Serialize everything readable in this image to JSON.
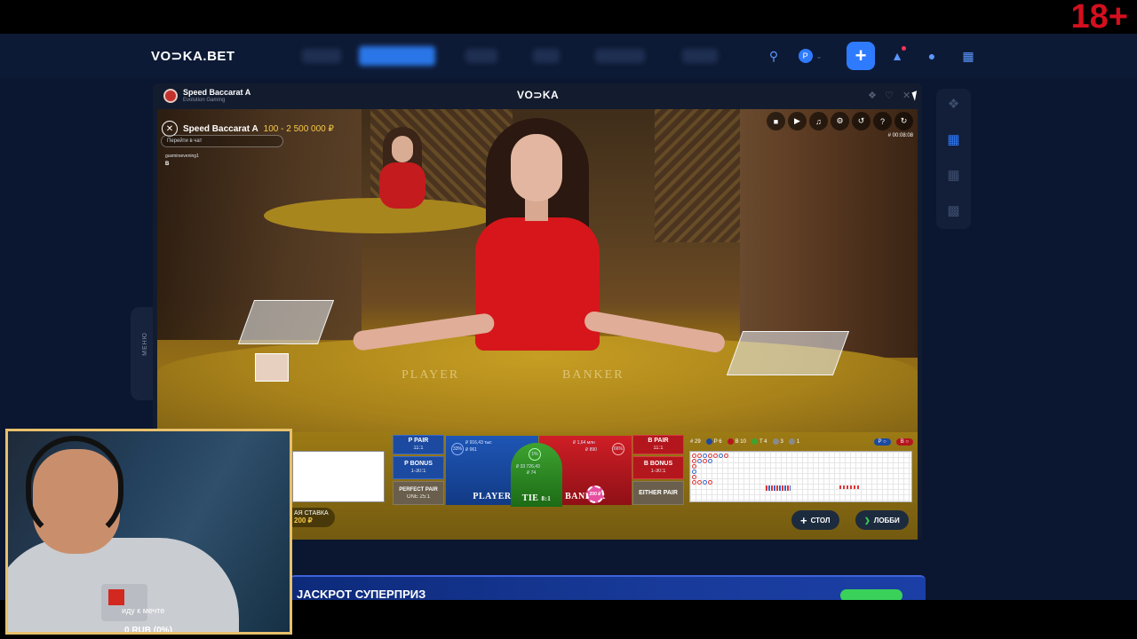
{
  "age_badge": "18+",
  "site": {
    "logo": "VO⊃KA.BET"
  },
  "game_window": {
    "title": "Speed Baccarat A",
    "provider": "Evolution Gaming",
    "brand": "VO⊃KA"
  },
  "video": {
    "game_name": "Speed Baccarat A",
    "limits": "100 - 2 500 000 ₽",
    "chat_placeholder": "Перейти в чат",
    "chat_user": "gusmirsevening1",
    "chat_message": "B",
    "round_id": "# 00:08:08",
    "table_player": "PLAYER",
    "table_banker": "BANKER"
  },
  "bets": {
    "p_pair": "P PAIR",
    "p_pair_odds": "11:1",
    "p_bonus": "P BONUS",
    "p_bonus_odds": "1-30:1",
    "perfect_pair": "PERFECT PAIR",
    "perfect_pair_odds": "ONE 25:1",
    "b_pair": "B PAIR",
    "b_pair_odds": "11:1",
    "b_bonus": "B BONUS",
    "b_bonus_odds": "1-30:1",
    "either_pair": "EITHER PAIR",
    "player": "PLAYER",
    "tie": "TIE",
    "tie_odds": "8:1",
    "banker": "BANKER",
    "player_pct": "33%",
    "banker_pct": "66%",
    "tie_pct": "1%",
    "player_total": "₽ 916,43 тыс",
    "player_count": "₽ 061",
    "banker_total": "₽ 1,64 млн",
    "banker_count": "₽ 890",
    "tie_total": "₽ 33 726,43",
    "tie_count": "₽ 74",
    "chip_value": "200 ₽",
    "last_bet_label": "АЯ СТАВКА",
    "last_bet_value": "200 ₽"
  },
  "road_stats": {
    "total": "# 29",
    "player": "P 6",
    "banker": "B 10",
    "tie": "T 4",
    "bpair": "3",
    "ppair": "1"
  },
  "buttons": {
    "table": "СТОЛ",
    "lobby": "ЛОББИ"
  },
  "side_menu": "МЕНЮ",
  "jackpot": "JACKPOT СУПЕРПРИЗ",
  "webcam": {
    "caption": "иду к мечте",
    "balance": "0 RUB (0%)"
  },
  "colors": {
    "accent": "#2f7bff",
    "player": "#1c4aa0",
    "banker": "#b4161e",
    "tie": "#3ea330",
    "limits": "#f7c948"
  },
  "icons": [
    "search-icon",
    "wallet-icon",
    "plus-icon",
    "bell-icon",
    "user-icon",
    "grid-icon",
    "chat-icon",
    "video-icon",
    "sound-icon",
    "settings-icon",
    "history-icon",
    "help-icon",
    "fullscreen-icon",
    "close-icon"
  ]
}
